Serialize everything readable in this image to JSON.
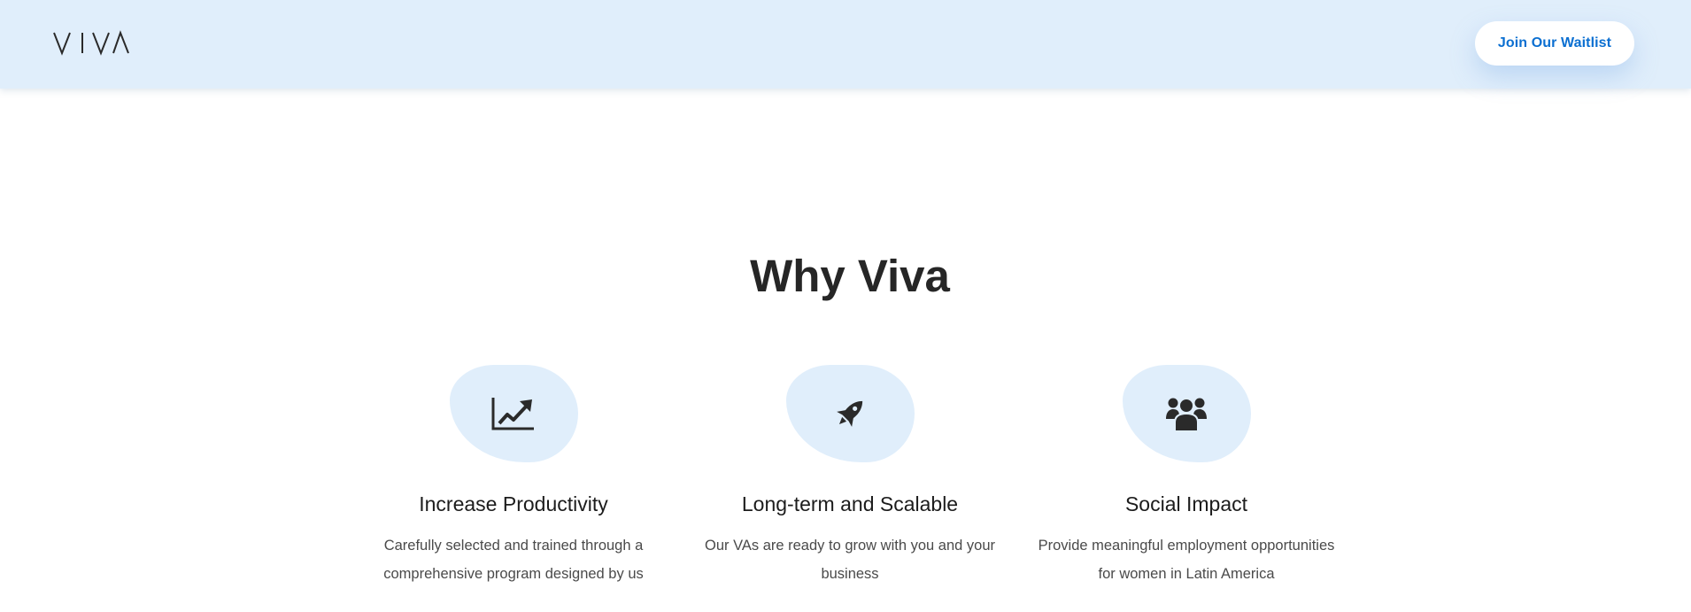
{
  "header": {
    "logo_text": "VIVA",
    "waitlist_label": "Join Our Waitlist"
  },
  "why": {
    "title": "Why Viva",
    "features": [
      {
        "icon": "chart-line-icon",
        "title": "Increase Productivity",
        "description": "Carefully selected and trained through a comprehensive program designed by us"
      },
      {
        "icon": "rocket-icon",
        "title": "Long-term and Scalable",
        "description": "Our VAs are ready to grow with you and your business"
      },
      {
        "icon": "users-icon",
        "title": "Social Impact",
        "description": "Provide meaningful employment opportunities for women in Latin America"
      }
    ]
  },
  "colors": {
    "header_bg": "#e0eefb",
    "accent": "#0b6fd1",
    "icon_bg": "#e0eefb",
    "heading": "#262626"
  }
}
